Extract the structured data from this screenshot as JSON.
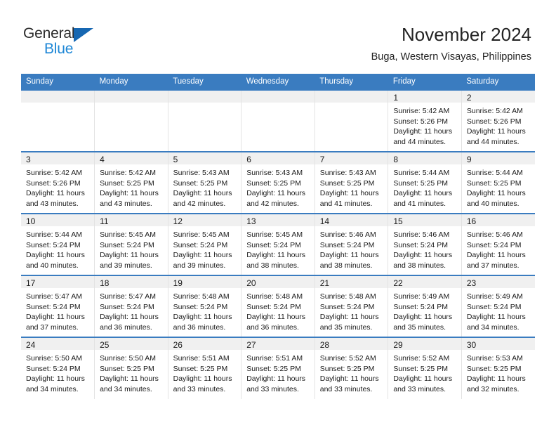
{
  "brand": {
    "name_part1": "General",
    "name_part2": "Blue"
  },
  "header": {
    "title": "November 2024",
    "subtitle": "Buga, Western Visayas, Philippines"
  },
  "colors": {
    "header_blue": "#3a7cc0",
    "logo_blue": "#1e87d6",
    "logo_triangle": "#1667b2",
    "daynum_band": "#f0f0f0"
  },
  "calendar": {
    "weekday_headers": [
      "Sunday",
      "Monday",
      "Tuesday",
      "Wednesday",
      "Thursday",
      "Friday",
      "Saturday"
    ],
    "weeks": [
      [
        {
          "day": "",
          "lines": []
        },
        {
          "day": "",
          "lines": []
        },
        {
          "day": "",
          "lines": []
        },
        {
          "day": "",
          "lines": []
        },
        {
          "day": "",
          "lines": []
        },
        {
          "day": "1",
          "lines": [
            "Sunrise: 5:42 AM",
            "Sunset: 5:26 PM",
            "Daylight: 11 hours",
            "and 44 minutes."
          ]
        },
        {
          "day": "2",
          "lines": [
            "Sunrise: 5:42 AM",
            "Sunset: 5:26 PM",
            "Daylight: 11 hours",
            "and 44 minutes."
          ]
        }
      ],
      [
        {
          "day": "3",
          "lines": [
            "Sunrise: 5:42 AM",
            "Sunset: 5:26 PM",
            "Daylight: 11 hours",
            "and 43 minutes."
          ]
        },
        {
          "day": "4",
          "lines": [
            "Sunrise: 5:42 AM",
            "Sunset: 5:25 PM",
            "Daylight: 11 hours",
            "and 43 minutes."
          ]
        },
        {
          "day": "5",
          "lines": [
            "Sunrise: 5:43 AM",
            "Sunset: 5:25 PM",
            "Daylight: 11 hours",
            "and 42 minutes."
          ]
        },
        {
          "day": "6",
          "lines": [
            "Sunrise: 5:43 AM",
            "Sunset: 5:25 PM",
            "Daylight: 11 hours",
            "and 42 minutes."
          ]
        },
        {
          "day": "7",
          "lines": [
            "Sunrise: 5:43 AM",
            "Sunset: 5:25 PM",
            "Daylight: 11 hours",
            "and 41 minutes."
          ]
        },
        {
          "day": "8",
          "lines": [
            "Sunrise: 5:44 AM",
            "Sunset: 5:25 PM",
            "Daylight: 11 hours",
            "and 41 minutes."
          ]
        },
        {
          "day": "9",
          "lines": [
            "Sunrise: 5:44 AM",
            "Sunset: 5:25 PM",
            "Daylight: 11 hours",
            "and 40 minutes."
          ]
        }
      ],
      [
        {
          "day": "10",
          "lines": [
            "Sunrise: 5:44 AM",
            "Sunset: 5:24 PM",
            "Daylight: 11 hours",
            "and 40 minutes."
          ]
        },
        {
          "day": "11",
          "lines": [
            "Sunrise: 5:45 AM",
            "Sunset: 5:24 PM",
            "Daylight: 11 hours",
            "and 39 minutes."
          ]
        },
        {
          "day": "12",
          "lines": [
            "Sunrise: 5:45 AM",
            "Sunset: 5:24 PM",
            "Daylight: 11 hours",
            "and 39 minutes."
          ]
        },
        {
          "day": "13",
          "lines": [
            "Sunrise: 5:45 AM",
            "Sunset: 5:24 PM",
            "Daylight: 11 hours",
            "and 38 minutes."
          ]
        },
        {
          "day": "14",
          "lines": [
            "Sunrise: 5:46 AM",
            "Sunset: 5:24 PM",
            "Daylight: 11 hours",
            "and 38 minutes."
          ]
        },
        {
          "day": "15",
          "lines": [
            "Sunrise: 5:46 AM",
            "Sunset: 5:24 PM",
            "Daylight: 11 hours",
            "and 38 minutes."
          ]
        },
        {
          "day": "16",
          "lines": [
            "Sunrise: 5:46 AM",
            "Sunset: 5:24 PM",
            "Daylight: 11 hours",
            "and 37 minutes."
          ]
        }
      ],
      [
        {
          "day": "17",
          "lines": [
            "Sunrise: 5:47 AM",
            "Sunset: 5:24 PM",
            "Daylight: 11 hours",
            "and 37 minutes."
          ]
        },
        {
          "day": "18",
          "lines": [
            "Sunrise: 5:47 AM",
            "Sunset: 5:24 PM",
            "Daylight: 11 hours",
            "and 36 minutes."
          ]
        },
        {
          "day": "19",
          "lines": [
            "Sunrise: 5:48 AM",
            "Sunset: 5:24 PM",
            "Daylight: 11 hours",
            "and 36 minutes."
          ]
        },
        {
          "day": "20",
          "lines": [
            "Sunrise: 5:48 AM",
            "Sunset: 5:24 PM",
            "Daylight: 11 hours",
            "and 36 minutes."
          ]
        },
        {
          "day": "21",
          "lines": [
            "Sunrise: 5:48 AM",
            "Sunset: 5:24 PM",
            "Daylight: 11 hours",
            "and 35 minutes."
          ]
        },
        {
          "day": "22",
          "lines": [
            "Sunrise: 5:49 AM",
            "Sunset: 5:24 PM",
            "Daylight: 11 hours",
            "and 35 minutes."
          ]
        },
        {
          "day": "23",
          "lines": [
            "Sunrise: 5:49 AM",
            "Sunset: 5:24 PM",
            "Daylight: 11 hours",
            "and 34 minutes."
          ]
        }
      ],
      [
        {
          "day": "24",
          "lines": [
            "Sunrise: 5:50 AM",
            "Sunset: 5:24 PM",
            "Daylight: 11 hours",
            "and 34 minutes."
          ]
        },
        {
          "day": "25",
          "lines": [
            "Sunrise: 5:50 AM",
            "Sunset: 5:25 PM",
            "Daylight: 11 hours",
            "and 34 minutes."
          ]
        },
        {
          "day": "26",
          "lines": [
            "Sunrise: 5:51 AM",
            "Sunset: 5:25 PM",
            "Daylight: 11 hours",
            "and 33 minutes."
          ]
        },
        {
          "day": "27",
          "lines": [
            "Sunrise: 5:51 AM",
            "Sunset: 5:25 PM",
            "Daylight: 11 hours",
            "and 33 minutes."
          ]
        },
        {
          "day": "28",
          "lines": [
            "Sunrise: 5:52 AM",
            "Sunset: 5:25 PM",
            "Daylight: 11 hours",
            "and 33 minutes."
          ]
        },
        {
          "day": "29",
          "lines": [
            "Sunrise: 5:52 AM",
            "Sunset: 5:25 PM",
            "Daylight: 11 hours",
            "and 33 minutes."
          ]
        },
        {
          "day": "30",
          "lines": [
            "Sunrise: 5:53 AM",
            "Sunset: 5:25 PM",
            "Daylight: 11 hours",
            "and 32 minutes."
          ]
        }
      ]
    ]
  }
}
